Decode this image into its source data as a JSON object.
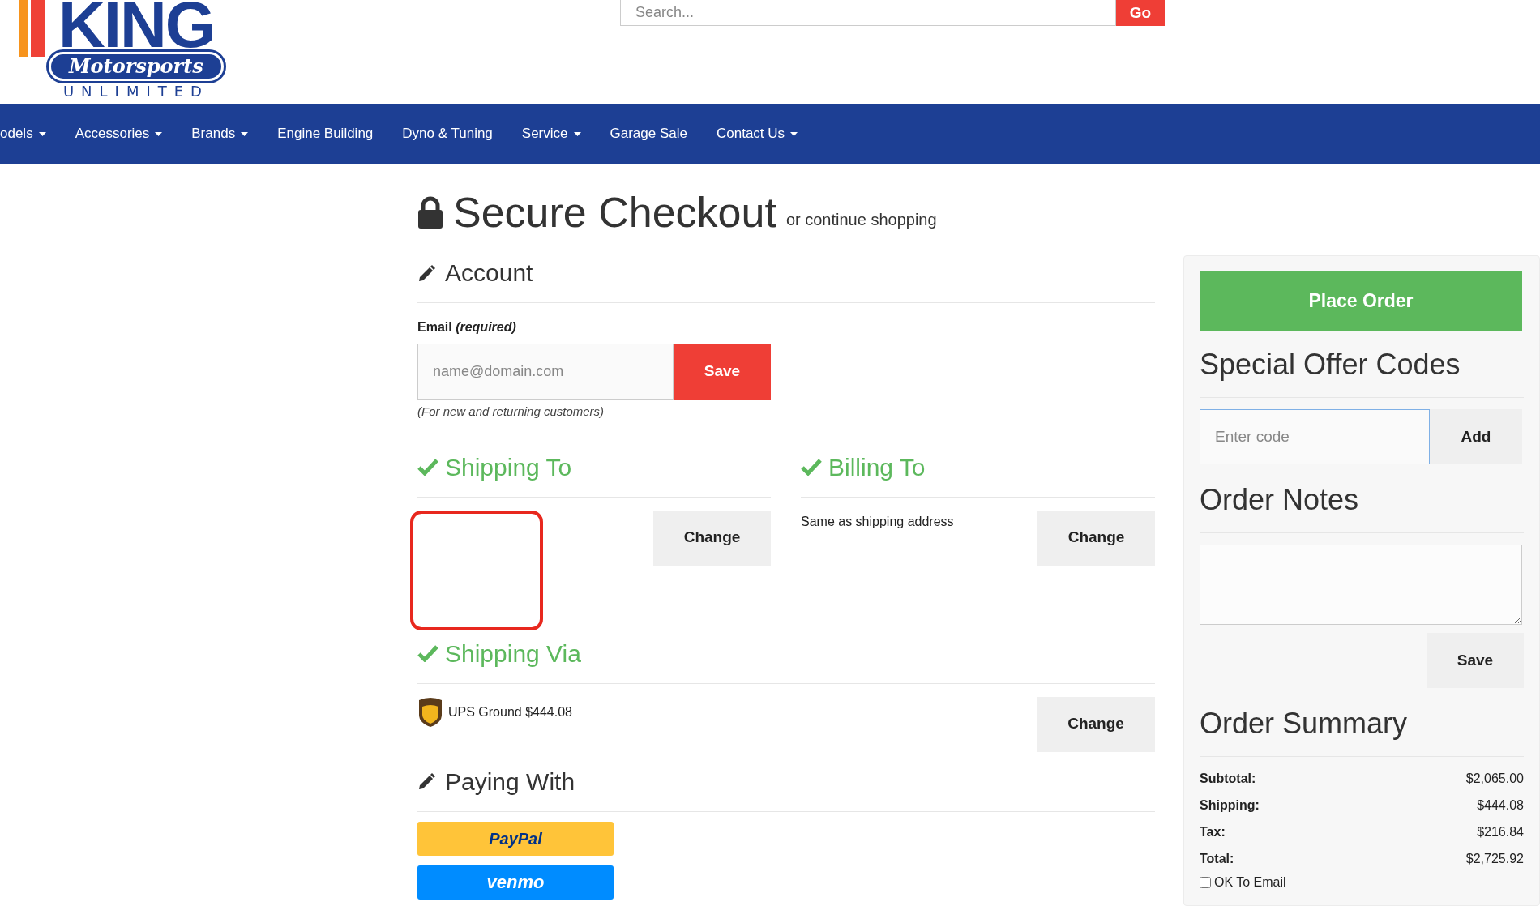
{
  "header": {
    "logo": {
      "name": "KING",
      "script": "Motorsports",
      "tagline": "UNLIMITED"
    },
    "search": {
      "placeholder": "Search..."
    },
    "search_button": "Go"
  },
  "nav": [
    {
      "label": "odels",
      "dropdown": true
    },
    {
      "label": "Accessories",
      "dropdown": true
    },
    {
      "label": "Brands",
      "dropdown": true
    },
    {
      "label": "Engine Building",
      "dropdown": false
    },
    {
      "label": "Dyno & Tuning",
      "dropdown": false
    },
    {
      "label": "Service",
      "dropdown": true
    },
    {
      "label": "Garage Sale",
      "dropdown": false
    },
    {
      "label": "Contact Us",
      "dropdown": true
    }
  ],
  "page": {
    "title": "Secure Checkout",
    "subtitle": "or continue shopping"
  },
  "account": {
    "heading": "Account",
    "email_label": "Email *(required)*",
    "email": {
      "placeholder": "name@domain.com"
    },
    "save": "Save",
    "note": "(For new and returning customers)"
  },
  "shipping_to": {
    "heading": "Shipping To",
    "done": true,
    "change": "Change"
  },
  "billing_to": {
    "heading": "Billing To",
    "done": true,
    "text": "Same as shipping address",
    "change": "Change"
  },
  "shipping_via": {
    "heading": "Shipping Via",
    "done": true,
    "text": "UPS Ground $444.08",
    "change": "Change"
  },
  "paying_with": {
    "heading": "Paying With",
    "methods": [
      {
        "kind": "paypal",
        "label": "PayPal"
      },
      {
        "kind": "venmo",
        "label": "venmo"
      }
    ]
  },
  "sidebar": {
    "place_order": "Place Order",
    "offer_heading": "Special Offer Codes",
    "code": {
      "placeholder": "Enter code"
    },
    "add": "Add",
    "notes_heading": "Order Notes",
    "notes_save": "Save",
    "summary_heading": "Order Summary",
    "summary": [
      {
        "label": "Subtotal:",
        "value": "$2,065.00"
      },
      {
        "label": "Shipping:",
        "value": "$444.08"
      },
      {
        "label": "Tax:",
        "value": "$216.84"
      },
      {
        "label": "Total:",
        "value": "$2,725.92"
      }
    ],
    "ok_to_email": {
      "label": "OK To Email",
      "checked": false
    }
  }
}
